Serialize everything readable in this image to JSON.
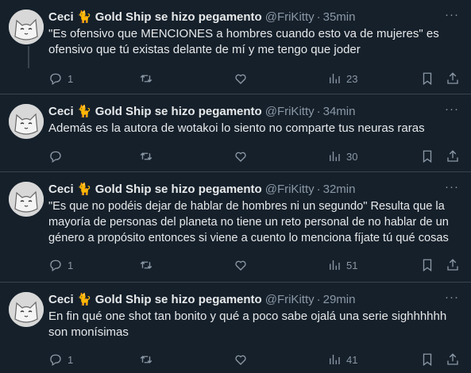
{
  "tweets": [
    {
      "author": {
        "display_name": "Ceci 🐈 Gold Ship se hizo pegamento",
        "handle": "@FriKitty"
      },
      "time": "35min",
      "text": "\"Es ofensivo que MENCIONES a hombres cuando esto va de mujeres\" es\nofensivo que tú existas delante de mí y me tengo que joder",
      "stats": {
        "replies": "1",
        "views": "23"
      }
    },
    {
      "author": {
        "display_name": "Ceci 🐈 Gold Ship se hizo pegamento",
        "handle": "@FriKitty"
      },
      "time": "34min",
      "text": "Además es la autora de wotakoi lo siento no comparte tus neuras raras",
      "stats": {
        "replies": "",
        "views": "30"
      }
    },
    {
      "author": {
        "display_name": "Ceci 🐈 Gold Ship se hizo pegamento",
        "handle": "@FriKitty"
      },
      "time": "32min",
      "text": "\"Es que no podéis dejar de hablar de hombres ni un segundo\" Resulta que la\nmayoría de personas del planeta no tiene un reto personal de no hablar de un\ngénero a propósito entonces si viene a cuento lo menciona fíjate tú qué cosas",
      "stats": {
        "replies": "1",
        "views": "51"
      }
    },
    {
      "author": {
        "display_name": "Ceci 🐈 Gold Ship se hizo pegamento",
        "handle": "@FriKitty"
      },
      "time": "29min",
      "text": "En fin qué one shot tan bonito y qué a poco sabe ojalá una serie sighhhhhh\nson monísimas",
      "stats": {
        "replies": "1",
        "views": "41"
      }
    }
  ],
  "separator": "·",
  "more_glyph": "···",
  "icons": [
    "reply-icon",
    "retweet-icon",
    "like-icon",
    "views-icon",
    "bookmark-icon",
    "share-icon"
  ],
  "colors": {
    "background": "#15202b",
    "text": "#e7e9ea",
    "secondary": "#8b98a5",
    "border": "#38444d"
  }
}
